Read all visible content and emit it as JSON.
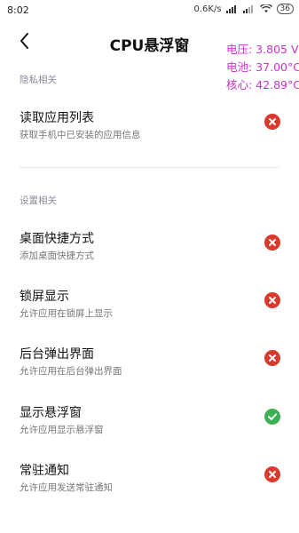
{
  "status_bar": {
    "time": "8:02",
    "network_speed": "0.6K/s",
    "battery": "36"
  },
  "header": {
    "title": "CPU悬浮窗"
  },
  "overlay": {
    "voltage": "电压: 3.805 V",
    "battery_temp": "电池: 37.00°C",
    "cpu_temp": "核心: 42.89°C"
  },
  "sections": {
    "privacy": "隐私相关",
    "settings": "设置相关"
  },
  "items": [
    {
      "title": "读取应用列表",
      "subtitle": "获取手机中已安装的应用信息",
      "status": "denied"
    },
    {
      "title": "桌面快捷方式",
      "subtitle": "添加桌面快捷方式",
      "status": "denied"
    },
    {
      "title": "锁屏显示",
      "subtitle": "允许应用在锁屏上显示",
      "status": "denied"
    },
    {
      "title": "后台弹出界面",
      "subtitle": "允许应用在后台弹出界面",
      "status": "denied"
    },
    {
      "title": "显示悬浮窗",
      "subtitle": "允许应用显示悬浮窗",
      "status": "allowed"
    },
    {
      "title": "常驻通知",
      "subtitle": "允许应用发送常驻通知",
      "status": "denied"
    }
  ],
  "colors": {
    "denied": "#d93a2b",
    "allowed": "#3cb054",
    "overlay_text": "#cc33cc"
  }
}
